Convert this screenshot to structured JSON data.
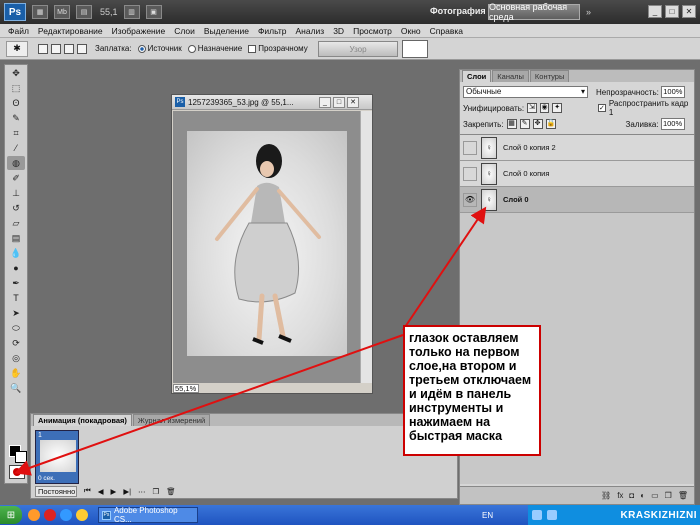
{
  "appbar": {
    "logo": "Ps",
    "mb_icon": "Mb",
    "zoom": "55,1",
    "workspace_label": "Фотография",
    "workspace_active": "Основная рабочая среда",
    "workspace_more": "»"
  },
  "menu": [
    "Файл",
    "Редактирование",
    "Изображение",
    "Слои",
    "Выделение",
    "Фильтр",
    "Анализ",
    "3D",
    "Просмотр",
    "Окно",
    "Справка"
  ],
  "options": {
    "patch_label": "Заплатка:",
    "source_label": "Источник",
    "destination_label": "Назначение",
    "transparent_label": "Прозрачному",
    "pattern_button": "Узор"
  },
  "document": {
    "icon": "Ps",
    "title": "1257239365_53.jpg @ 55,1...",
    "zoom": "55,1%"
  },
  "layers_panel": {
    "tabs": [
      "Слои",
      "Каналы",
      "Контуры"
    ],
    "blend_mode": "Обычные",
    "opacity_label": "Непрозрачность:",
    "opacity_value": "100%",
    "unify_label": "Унифицировать:",
    "propagate_label": "Распространить кадр 1",
    "lock_label": "Закрепить:",
    "fill_label": "Заливка:",
    "fill_value": "100%",
    "layers": [
      {
        "name": "Слой 0 копия 2",
        "visible": false
      },
      {
        "name": "Слой 0 копия",
        "visible": false
      },
      {
        "name": "Слой 0",
        "visible": true
      }
    ],
    "footer_icons": [
      "link-icon",
      "fx-icon",
      "mask-icon",
      "adjustment-icon",
      "folder-icon",
      "new-layer-icon",
      "trash-icon"
    ]
  },
  "animation": {
    "tabs": [
      "Анимация (покадровая)",
      "Журнал измерений"
    ],
    "frame_number": "1",
    "frame_time": "0 сек.",
    "loop": "Постоянно"
  },
  "annotation": "глазок оставляем только на первом слое,на втором и третьем отключаем и идём в панель инструменты и нажимаем на быстрая маска",
  "taskbar": {
    "task_label": "Adobe Photoshop CS...",
    "language": "EN",
    "watermark": "KRASKIZHIZNI"
  },
  "colors": {
    "annotation_border": "#cc0000",
    "arrow": "#e01010",
    "taskbar": "#2a62cc",
    "active_frame": "#3d6fb8"
  }
}
